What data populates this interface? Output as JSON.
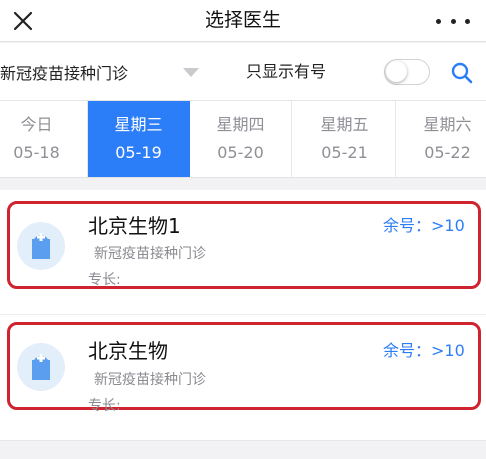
{
  "header": {
    "title": "选择医生",
    "close_icon": "close-icon",
    "more_icon": "more-dots-icon"
  },
  "filter": {
    "department": "新冠疫苗接种门诊",
    "only_available_label": "只显示有号",
    "only_available_enabled": false,
    "search_icon": "search-icon"
  },
  "dates": [
    {
      "weekday": "今日",
      "date": "05-18",
      "selected": false
    },
    {
      "weekday": "星期三",
      "date": "05-19",
      "selected": true
    },
    {
      "weekday": "星期四",
      "date": "05-20",
      "selected": false
    },
    {
      "weekday": "星期五",
      "date": "05-21",
      "selected": false
    },
    {
      "weekday": "星期六",
      "date": "05-22",
      "selected": false
    }
  ],
  "doctors": [
    {
      "name": "北京生物1",
      "remaining": "余号：>10",
      "department": "新冠疫苗接种门诊",
      "specialty": "专长:",
      "highlighted": true
    },
    {
      "name": "北京生物",
      "remaining": "余号：>10",
      "department": "新冠疫苗接种门诊",
      "specialty": "专长:",
      "highlighted": true
    }
  ],
  "colors": {
    "accent": "#2c7ef8",
    "highlight_border": "#cf2430",
    "avatar_bg": "#e3eefb",
    "avatar_icon": "#5b9ef0",
    "page_bg": "#f2f2f4"
  }
}
